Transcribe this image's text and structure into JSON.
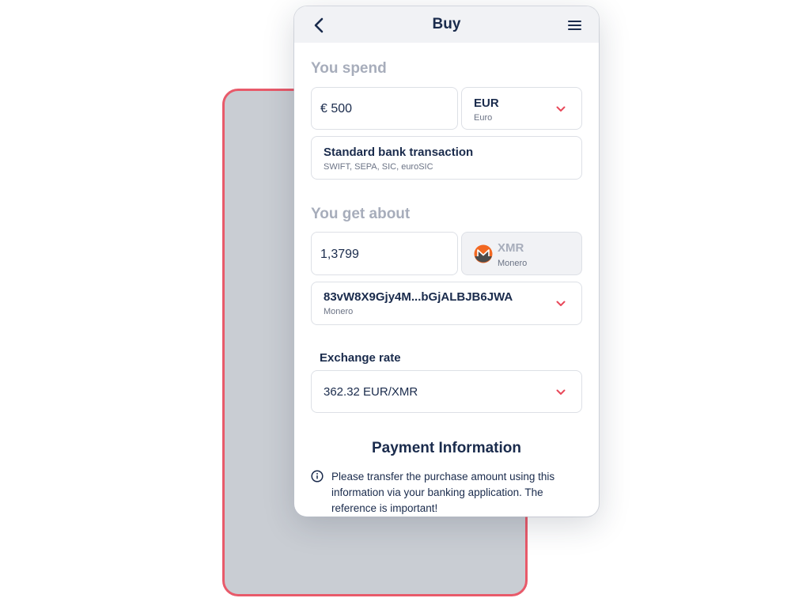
{
  "header": {
    "title": "Buy"
  },
  "spend": {
    "label": "You spend",
    "amount": "€ 500",
    "currency_code": "EUR",
    "currency_name": "Euro",
    "method_title": "Standard bank transaction",
    "method_sub": "SWIFT, SEPA, SIC, euroSIC"
  },
  "get": {
    "label": "You get about",
    "amount": "1,3799",
    "currency_code": "XMR",
    "currency_name": "Monero",
    "wallet_address": "83vW8X9Gjy4M...bGjALBJB6JWA",
    "wallet_network": "Monero"
  },
  "rate": {
    "label": "Exchange rate",
    "value": "362.32 EUR/XMR"
  },
  "payment": {
    "title": "Payment Information",
    "info": "Please transfer the purchase amount using this information via your banking application. The reference is important!"
  },
  "colors": {
    "accent": "#e8485a",
    "muted_label": "#a7adbb",
    "text": "#1a2b4c",
    "monero_orange": "#f26822"
  },
  "icons": [
    "back-arrow-icon",
    "hamburger-menu-icon",
    "chevron-down-icon",
    "monero-logo-icon",
    "info-icon"
  ]
}
